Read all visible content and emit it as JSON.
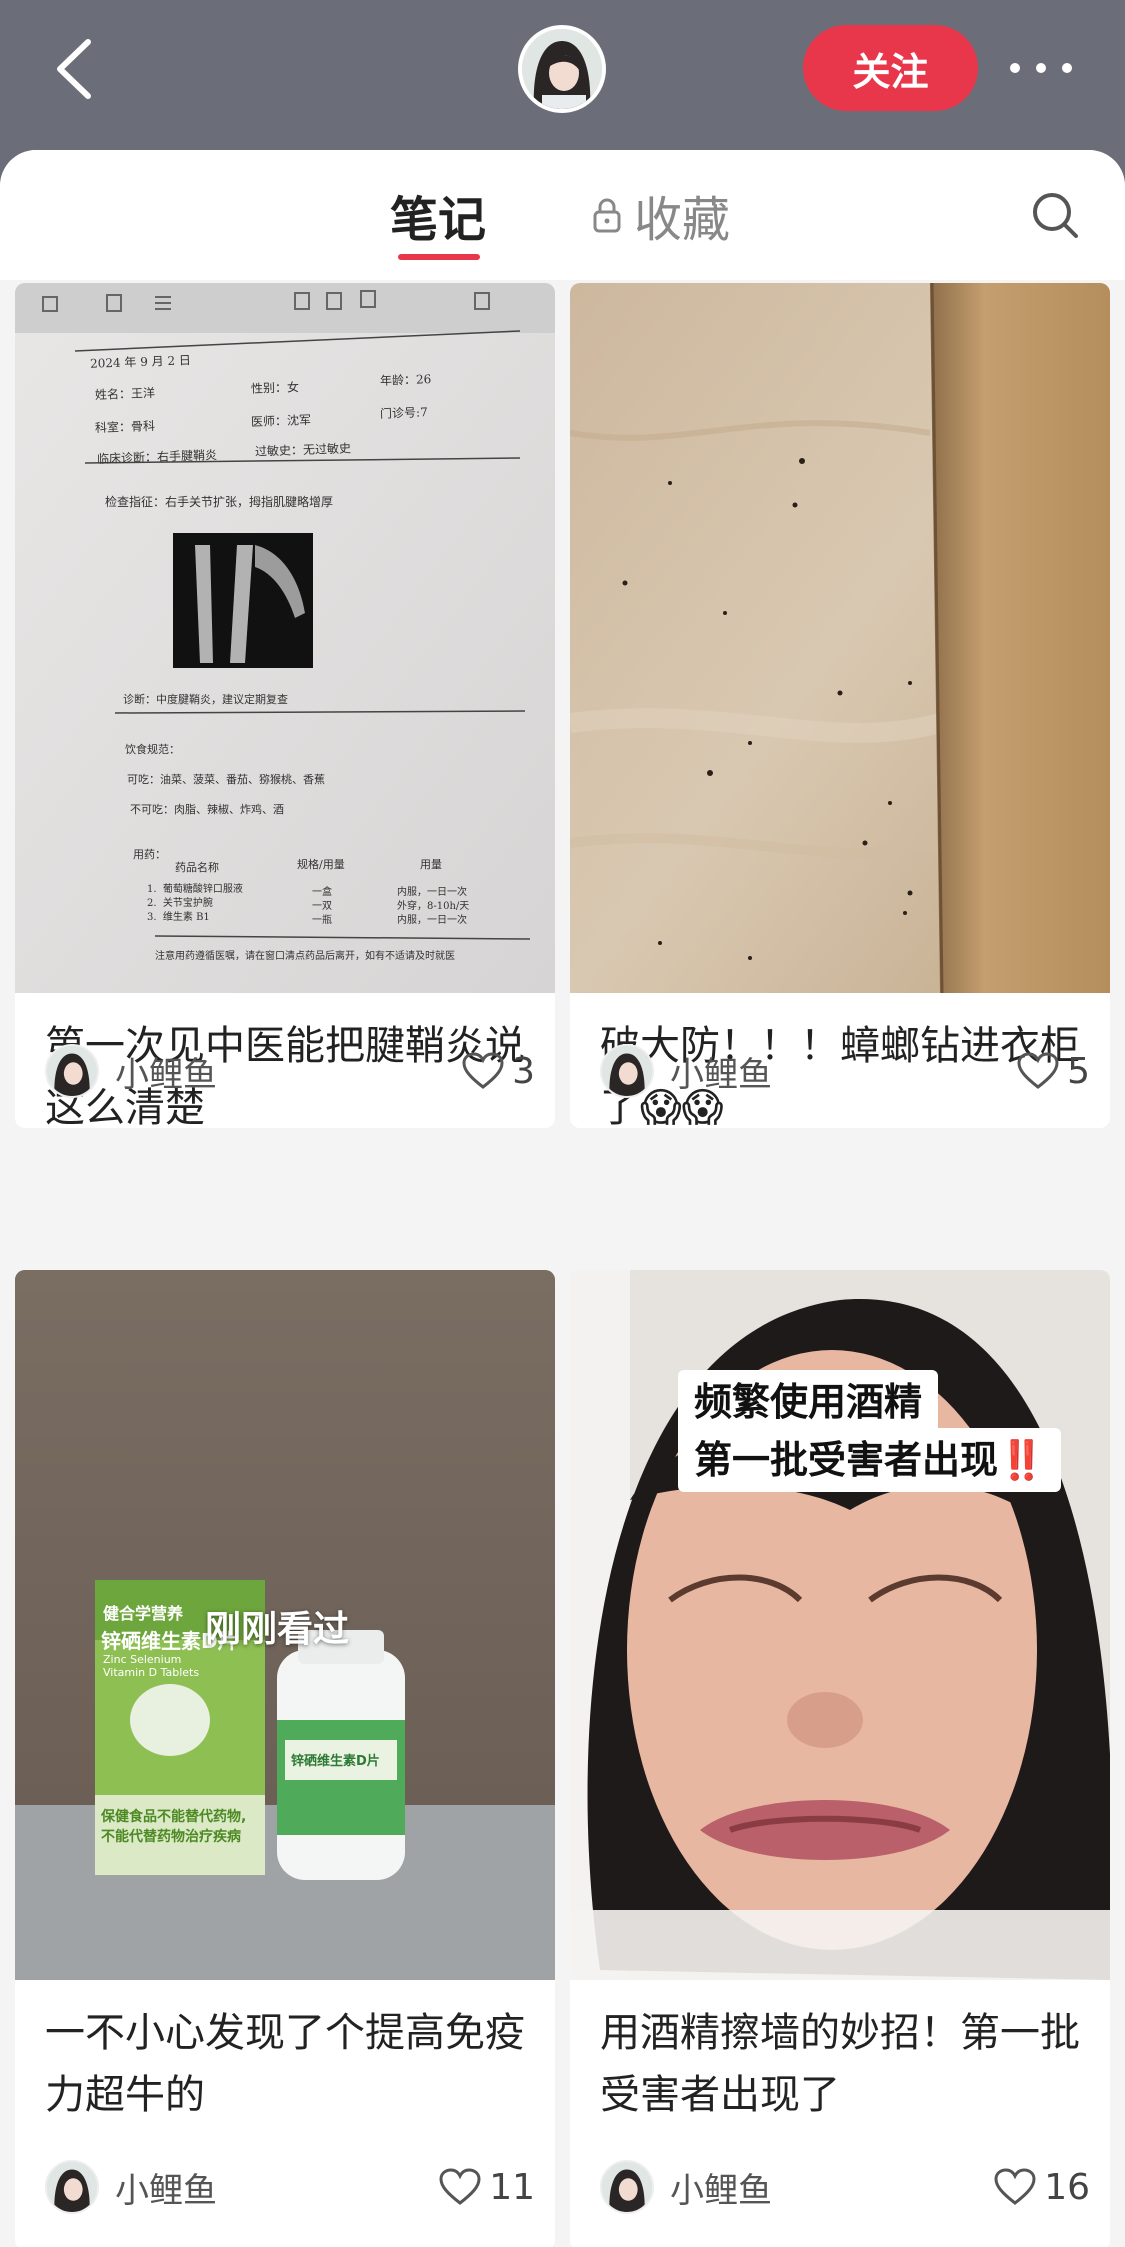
{
  "header": {
    "follow_label": "关注"
  },
  "tabs": {
    "notes": "笔记",
    "collect": "收藏"
  },
  "notes": [
    {
      "title": "第一次见中医能把腱鞘炎说这么清楚",
      "author": "小鲤鱼",
      "likes": "3",
      "image": {
        "date": "2024 年 9 月 2 日",
        "name": "姓名：王洋",
        "gender": "性别：女",
        "age": "年龄：26",
        "dept": "科室：骨科",
        "doctor": "医师：沈军",
        "clinic_no": "门诊号:7",
        "diagnosis_line": "临床诊断：右手腱鞘炎",
        "allergy": "过敏史：无过敏史",
        "exam": "检查指征：右手关节扩张，拇指肌腱略增厚",
        "conclusion": "诊断：中度腱鞘炎，建议定期复查",
        "diet_title": "饮食规范：",
        "diet_ok": "可吃：油菜、菠菜、番茄、猕猴桃、香蕉",
        "diet_no": "不可吃：肉脂、辣椒、炸鸡、酒",
        "med_title": "用药：",
        "med_header_name": "药品名称",
        "med_header_spec": "规格/用量",
        "med_header_dose": "用量",
        "meds": [
          {
            "no": "1.",
            "name": "葡萄糖酸锌口服液",
            "spec": "一盒",
            "dose": "内服，一日一次"
          },
          {
            "no": "2.",
            "name": "关节宝护腕",
            "spec": "一双",
            "dose": "外穿，8-10h/天"
          },
          {
            "no": "3.",
            "name": "维生素 B1",
            "spec": "一瓶",
            "dose": "内服，一日一次"
          }
        ],
        "footer": "注意用药遵循医嘱，请在窗口清点药品后离开，如有不适请及时就医"
      }
    },
    {
      "title": "破大防！！！蟑螂钻进衣柜了😱😱",
      "author": "小鲤鱼",
      "likes": "5"
    },
    {
      "title": "一不小心发现了个提高免疫力超牛的",
      "author": "小鲤鱼",
      "likes": "11",
      "overlay": "刚刚看过",
      "product": {
        "box_brand": "健合学营养",
        "box_name": "锌硒维生素D片",
        "box_en1": "Zinc Selenium",
        "box_en2": "Vitamin D Tablets",
        "box_warn1": "保健食品不能替代药物,",
        "box_warn2": "不能代替药物治疗疾病",
        "bottle_name": "锌硒维生素D片"
      }
    },
    {
      "title": "用酒精擦墙的妙招！第一批受害者出现了",
      "author": "小鲤鱼",
      "likes": "16",
      "caption_line1": "频繁使用酒精",
      "caption_line2": "第一批受害者出现",
      "caption_mark": "‼️"
    }
  ]
}
